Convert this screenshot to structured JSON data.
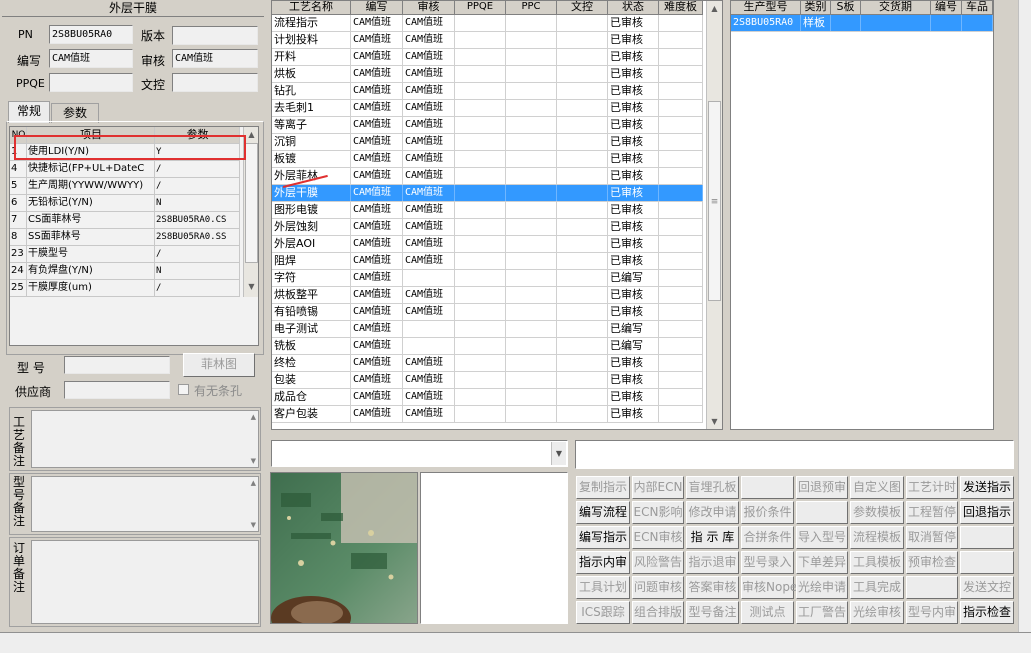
{
  "left": {
    "title": "外层干膜",
    "pn_label": "PN",
    "pn_value": "2S8BU05RA0",
    "version_label": "版本",
    "version_value": "",
    "writer_label": "编写",
    "writer_value": "CAM值班",
    "reviewer_label": "审核",
    "reviewer_value": "CAM值班",
    "ppqe_label": "PPQE",
    "ppqe_value": "",
    "wenkong_label": "文控",
    "wenkong_value": "",
    "tabs": [
      "常规",
      "参数"
    ],
    "param_headers": {
      "no": "NO",
      "item": "项目",
      "param": "参数"
    },
    "params": [
      {
        "no": "1",
        "item": "使用LDI(Y/N)",
        "param": "Y"
      },
      {
        "no": "4",
        "item": "快捷标记(FP+UL+DateC",
        "param": "/"
      },
      {
        "no": "5",
        "item": "生产周期(YYWW/WWYY)",
        "param": "/"
      },
      {
        "no": "6",
        "item": "无铅标记(Y/N)",
        "param": "N"
      },
      {
        "no": "7",
        "item": "CS面菲林号",
        "param": "2S8BU05RA0.CS"
      },
      {
        "no": "8",
        "item": "SS面菲林号",
        "param": "2S8BU05RA0.SS"
      },
      {
        "no": "23",
        "item": "干膜型号",
        "param": "/"
      },
      {
        "no": "24",
        "item": "有负焊盘(Y/N)",
        "param": "N"
      },
      {
        "no": "25",
        "item": "干膜厚度(um)",
        "param": "/"
      }
    ],
    "model_label": "型 号",
    "model_value": "",
    "film_button": "菲林图",
    "supplier_label": "供应商",
    "supplier_value": "",
    "no_strip_label": "有无条孔",
    "memo_labels": [
      "工艺备注",
      "型号备注",
      "订单备注"
    ]
  },
  "process_table": {
    "headers": [
      "工艺名称",
      "编写",
      "审核",
      "PPQE",
      "PPC",
      "文控",
      "状态",
      "难度板"
    ],
    "rows": [
      {
        "name": "流程指示",
        "writer": "CAM值班",
        "reviewer": "CAM值班",
        "status": "已审核"
      },
      {
        "name": "计划投料",
        "writer": "CAM值班",
        "reviewer": "CAM值班",
        "status": "已审核"
      },
      {
        "name": "开料",
        "writer": "CAM值班",
        "reviewer": "CAM值班",
        "status": "已审核"
      },
      {
        "name": "烘板",
        "writer": "CAM值班",
        "reviewer": "CAM值班",
        "status": "已审核"
      },
      {
        "name": "钻孔",
        "writer": "CAM值班",
        "reviewer": "CAM值班",
        "status": "已审核"
      },
      {
        "name": "去毛刺1",
        "writer": "CAM值班",
        "reviewer": "CAM值班",
        "status": "已审核"
      },
      {
        "name": "等离子",
        "writer": "CAM值班",
        "reviewer": "CAM值班",
        "status": "已审核"
      },
      {
        "name": "沉铜",
        "writer": "CAM值班",
        "reviewer": "CAM值班",
        "status": "已审核"
      },
      {
        "name": "板镀",
        "writer": "CAM值班",
        "reviewer": "CAM值班",
        "status": "已审核"
      },
      {
        "name": "外层菲林",
        "writer": "CAM值班",
        "reviewer": "CAM值班",
        "status": "已审核"
      },
      {
        "name": "外层干膜",
        "writer": "CAM值班",
        "reviewer": "CAM值班",
        "status": "已审核"
      },
      {
        "name": "图形电镀",
        "writer": "CAM值班",
        "reviewer": "CAM值班",
        "status": "已审核"
      },
      {
        "name": "外层蚀刻",
        "writer": "CAM值班",
        "reviewer": "CAM值班",
        "status": "已审核"
      },
      {
        "name": "外层AOI",
        "writer": "CAM值班",
        "reviewer": "CAM值班",
        "status": "已审核"
      },
      {
        "name": "阻焊",
        "writer": "CAM值班",
        "reviewer": "CAM值班",
        "status": "已审核"
      },
      {
        "name": "字符",
        "writer": "CAM值班",
        "reviewer": "",
        "status": "已编写"
      },
      {
        "name": "烘板整平",
        "writer": "CAM值班",
        "reviewer": "CAM值班",
        "status": "已审核"
      },
      {
        "name": "有铅喷锡",
        "writer": "CAM值班",
        "reviewer": "CAM值班",
        "status": "已审核"
      },
      {
        "name": "电子测试",
        "writer": "CAM值班",
        "reviewer": "",
        "status": "已编写"
      },
      {
        "name": "铣板",
        "writer": "CAM值班",
        "reviewer": "",
        "status": "已编写"
      },
      {
        "name": "终检",
        "writer": "CAM值班",
        "reviewer": "CAM值班",
        "status": "已审核"
      },
      {
        "name": "包装",
        "writer": "CAM值班",
        "reviewer": "CAM值班",
        "status": "已审核"
      },
      {
        "name": "成品仓",
        "writer": "CAM值班",
        "reviewer": "CAM值班",
        "status": "已审核"
      },
      {
        "name": "客户包装",
        "writer": "CAM值班",
        "reviewer": "CAM值班",
        "status": "已审核"
      }
    ]
  },
  "model_table": {
    "headers": [
      "生产型号",
      "类别",
      "S板",
      "交货期",
      "编号",
      "车品"
    ],
    "rows": [
      {
        "model": "2S8BU05RA0",
        "category": "样板",
        "sboard": "",
        "delivery": "",
        "number": "",
        "car": ""
      }
    ]
  },
  "buttons": [
    [
      "复制指示",
      "内部ECN",
      "盲埋孔板",
      "",
      "回退预审",
      "自定义图",
      "工艺计时",
      "发送指示"
    ],
    [
      "编写流程",
      "ECN影响",
      "修改申请",
      "报价条件",
      "",
      "参数模板",
      "工程暂停",
      "回退指示"
    ],
    [
      "编写指示",
      "ECN审核",
      "指 示 库",
      "合拼条件",
      "导入型号",
      "流程模板",
      "取消暂停",
      ""
    ],
    [
      "指示内审",
      "风险警告",
      "指示退审",
      "型号录入",
      "下单差异",
      "工具模板",
      "预审检查",
      ""
    ],
    [
      "工具计划",
      "问题审核",
      "答案审核",
      "审核Nope",
      "光绘申请",
      "工具完成",
      "",
      "发送文控"
    ],
    [
      "ICS跟踪",
      "组合排版",
      "型号备注",
      "测试点",
      "工厂警告",
      "光绘审核",
      "型号内审",
      "指示检查"
    ]
  ],
  "button_enabled": [
    [
      false,
      false,
      false,
      false,
      false,
      false,
      false,
      true
    ],
    [
      true,
      false,
      false,
      false,
      false,
      false,
      false,
      true
    ],
    [
      true,
      false,
      true,
      false,
      false,
      false,
      false,
      false
    ],
    [
      true,
      false,
      false,
      false,
      false,
      false,
      false,
      false
    ],
    [
      false,
      false,
      false,
      false,
      false,
      false,
      false,
      false
    ],
    [
      false,
      false,
      false,
      false,
      false,
      false,
      false,
      true
    ]
  ],
  "colors": {
    "selection": "#3399ff",
    "annotation": "#e03030"
  }
}
